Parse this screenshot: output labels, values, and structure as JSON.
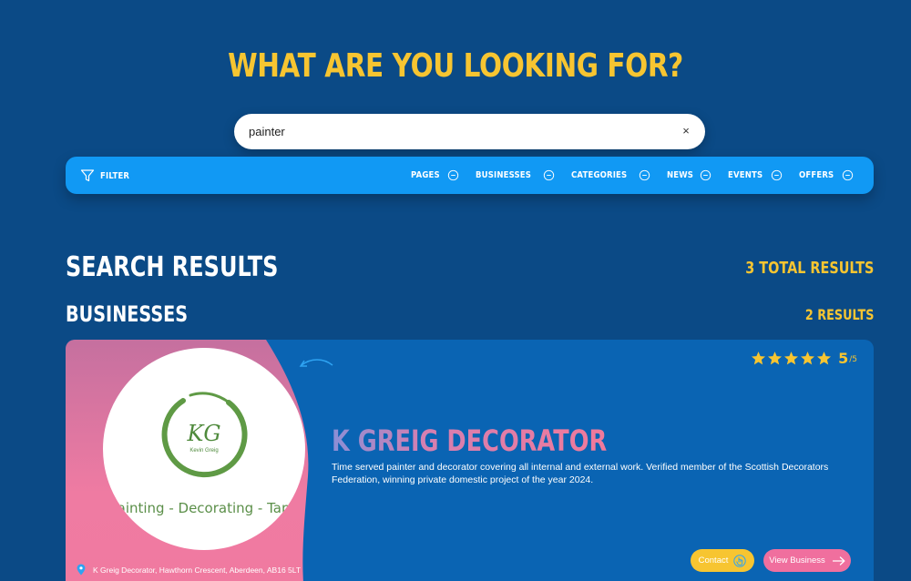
{
  "hero": {
    "title": "WHAT ARE YOU LOOKING FOR?"
  },
  "search": {
    "value": "painter",
    "clear_label": "×"
  },
  "filterbar": {
    "filter_label": "FILTER",
    "tabs": [
      {
        "label": "PAGES"
      },
      {
        "label": "BUSINESSES"
      },
      {
        "label": "CATEGORIES"
      },
      {
        "label": "NEWS"
      },
      {
        "label": "EVENTS"
      },
      {
        "label": "OFFERS"
      }
    ]
  },
  "results": {
    "title": "SEARCH RESULTS",
    "total": "3 TOTAL RESULTS",
    "section_title": "BUSINESSES",
    "section_count": "2 RESULTS"
  },
  "business": {
    "name": "K GREIG DECORATOR",
    "description": "Time served painter and decorator covering all internal and external work. Verified member of the Scottish Decorators Federation, winning private domestic project of the year 2024.",
    "rating_value": "5",
    "rating_max": "/5",
    "rating": 5,
    "logo": {
      "monogram": "KG",
      "owner": "Kevin Greig",
      "tagline": "Painting - Decorating - Taping"
    },
    "address": "K Greig Decorator, Hawthorn Crescent, Aberdeen, AB16 5LT",
    "contact_label": "Contact",
    "view_label": "View Business"
  },
  "colors": {
    "background": "#0b4a86",
    "accent_yellow": "#f7c531",
    "filterbar_blue": "#1199f4",
    "card_blue": "#0a64b3",
    "pink": "#f06f9e"
  }
}
